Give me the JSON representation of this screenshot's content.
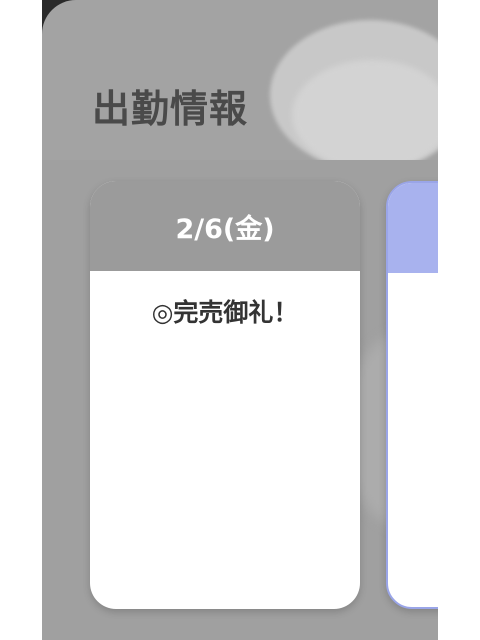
{
  "section": {
    "title": "出勤情報"
  },
  "schedule": {
    "cards": [
      {
        "date": "2/6(金)",
        "status": "◎完売御礼！",
        "header_color": "#9b9b9b"
      },
      {
        "date": "",
        "status": "",
        "header_color": "#a8b2ee"
      }
    ]
  }
}
